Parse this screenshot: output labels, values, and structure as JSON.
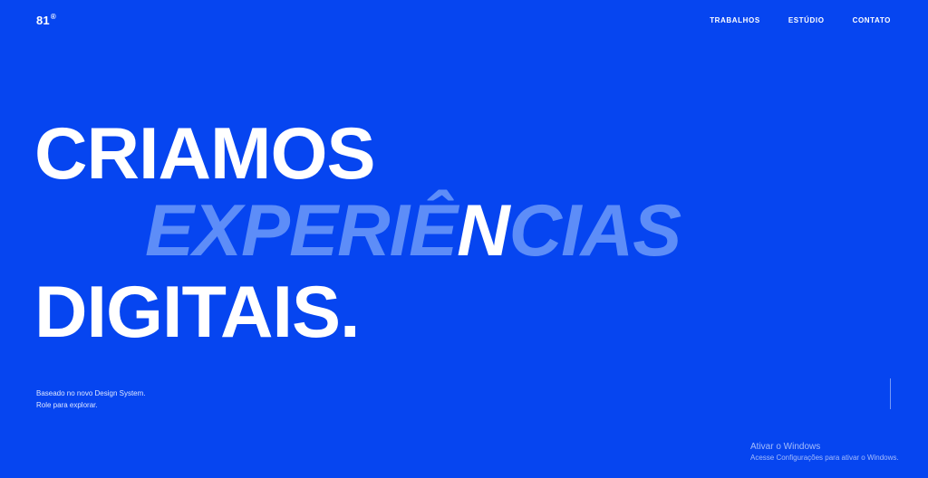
{
  "header": {
    "logo": "81",
    "logo_mark": "®",
    "nav": [
      {
        "label": "TRABALHOS"
      },
      {
        "label": "ESTÚDIO"
      },
      {
        "label": "CONTATO"
      }
    ]
  },
  "hero": {
    "line1": "CRIAMOS",
    "line2_before": "EXPERIÊ",
    "line2_highlight": "N",
    "line2_after": "CIAS",
    "line3": "DIGITAIS."
  },
  "tagline": {
    "line1": "Baseado no novo Design System.",
    "line2": "Role para explorar."
  },
  "watermark": {
    "title": "Ativar o Windows",
    "subtitle": "Acesse Configurações para ativar o Windows."
  },
  "colors": {
    "background": "#0645f0",
    "text": "#ffffff",
    "accent_text": "#5d8df8"
  }
}
